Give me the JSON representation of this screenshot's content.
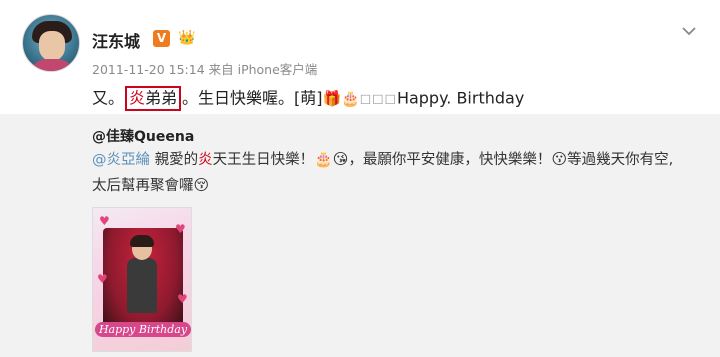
{
  "post": {
    "username": "汪东城",
    "verified_badge": "V",
    "level_badge_icon": "crown-emoji",
    "timestamp": "2011-11-20 15:14",
    "source": "来自 iPhone客户端",
    "text_prefix": "又。",
    "highlight_red": "炎",
    "highlight_rest": "弟弟",
    "text_after_highlight": "。生日快樂喔。[萌]",
    "emoji_1": "🎁",
    "emoji_2": "🎂",
    "placeholder_boxes": "□□□",
    "text_suffix": "Happy. Birthday"
  },
  "repost": {
    "username": "@佳臻Queena",
    "line1": {
      "mention": "@炎亞綸",
      "seg1": " 親愛的",
      "fire": "炎",
      "seg2": "天王生日快樂！",
      "emoji_a": "🎂",
      "emoji_b": "😘",
      "seg3": "，最願你平安健康，快快樂樂！",
      "emoji_c": "😗",
      "seg4": "等過幾天你有空,"
    },
    "line2": {
      "text": "太后幫再聚會囉",
      "emoji": "😚"
    },
    "image_caption": "Happy Birthday"
  },
  "colors": {
    "highlight_border": "#d0021b",
    "mention": "#5b8fb9",
    "verified": "#f07b1e",
    "repost_bg": "#f2f2f2"
  }
}
